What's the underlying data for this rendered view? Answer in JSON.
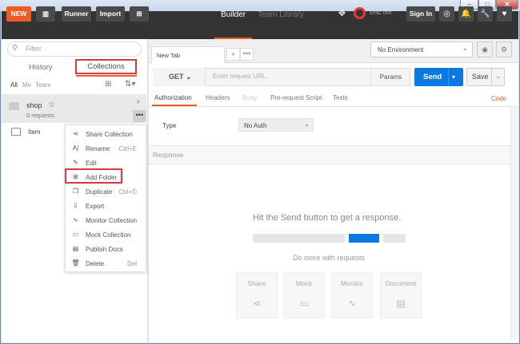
{
  "window": {
    "min": "–",
    "max": "□",
    "close": "✕"
  },
  "header": {
    "new_label": "NEW",
    "runner_label": "Runner",
    "import_label": "Import",
    "tabs": [
      "Builder",
      "Team Library"
    ],
    "sync_label": "SYNC OFF",
    "signin_label": "Sign In",
    "icons": {
      "layout": "▥",
      "new_window": "⊞",
      "sync": "✥",
      "satellite": "◎",
      "bell": "🔔",
      "wrench": "🔧",
      "heart": "♥"
    }
  },
  "sidebar": {
    "filter_placeholder": "Filter",
    "tabs": [
      "History",
      "Collections"
    ],
    "filters": [
      "All",
      "Me",
      "Team"
    ],
    "collection": {
      "name": "shop",
      "count": "0 requests"
    },
    "item": "Item"
  },
  "context_menu": [
    {
      "label": "Share Collection",
      "shortcut": "",
      "icon": "share-icon",
      "glyph": "⋖"
    },
    {
      "label": "Rename",
      "shortcut": "Ctrl+E",
      "icon": "rename-icon",
      "glyph": "A|"
    },
    {
      "label": "Edit",
      "shortcut": "",
      "icon": "pencil-icon",
      "glyph": "✎"
    },
    {
      "label": "Add Folder",
      "shortcut": "",
      "icon": "add-folder-icon",
      "glyph": "⊞"
    },
    {
      "label": "Duplicate",
      "shortcut": "Ctrl+D",
      "icon": "duplicate-icon",
      "glyph": "❐"
    },
    {
      "label": "Export",
      "shortcut": "",
      "icon": "export-icon",
      "glyph": "⇩"
    },
    {
      "label": "Monitor Collection",
      "shortcut": "",
      "icon": "monitor-icon",
      "glyph": "∿"
    },
    {
      "label": "Mock Collection",
      "shortcut": "",
      "icon": "mock-icon",
      "glyph": "▭"
    },
    {
      "label": "Publish Docs",
      "shortcut": "",
      "icon": "docs-icon",
      "glyph": "▤"
    },
    {
      "label": "Delete",
      "shortcut": "Del",
      "icon": "trash-icon",
      "glyph": "🗑"
    }
  ],
  "main": {
    "tab_label": "New Tab",
    "environment": "No Environment",
    "method": "GET",
    "url_placeholder": "Enter request URL",
    "params_label": "Params",
    "send_label": "Send",
    "save_label": "Save",
    "request_tabs": [
      "Authorization",
      "Headers",
      "Body",
      "Pre-request Script",
      "Tests"
    ],
    "code_label": "Code",
    "type_label": "Type",
    "auth_value": "No Auth",
    "response_label": "Response",
    "hint": "Hit the Send button to get a response.",
    "more_label": "Do more with requests",
    "cards": [
      {
        "title": "Share",
        "icon": "share-icon",
        "glyph": "⋖"
      },
      {
        "title": "Mock",
        "icon": "mock-icon",
        "glyph": "▭"
      },
      {
        "title": "Monitor",
        "icon": "monitor-icon",
        "glyph": "∿"
      },
      {
        "title": "Document",
        "icon": "document-icon",
        "glyph": "▤"
      }
    ]
  },
  "colors": {
    "accent": "#ef5b25",
    "send": "#0b79e1",
    "highlight": "#d83b3b"
  }
}
